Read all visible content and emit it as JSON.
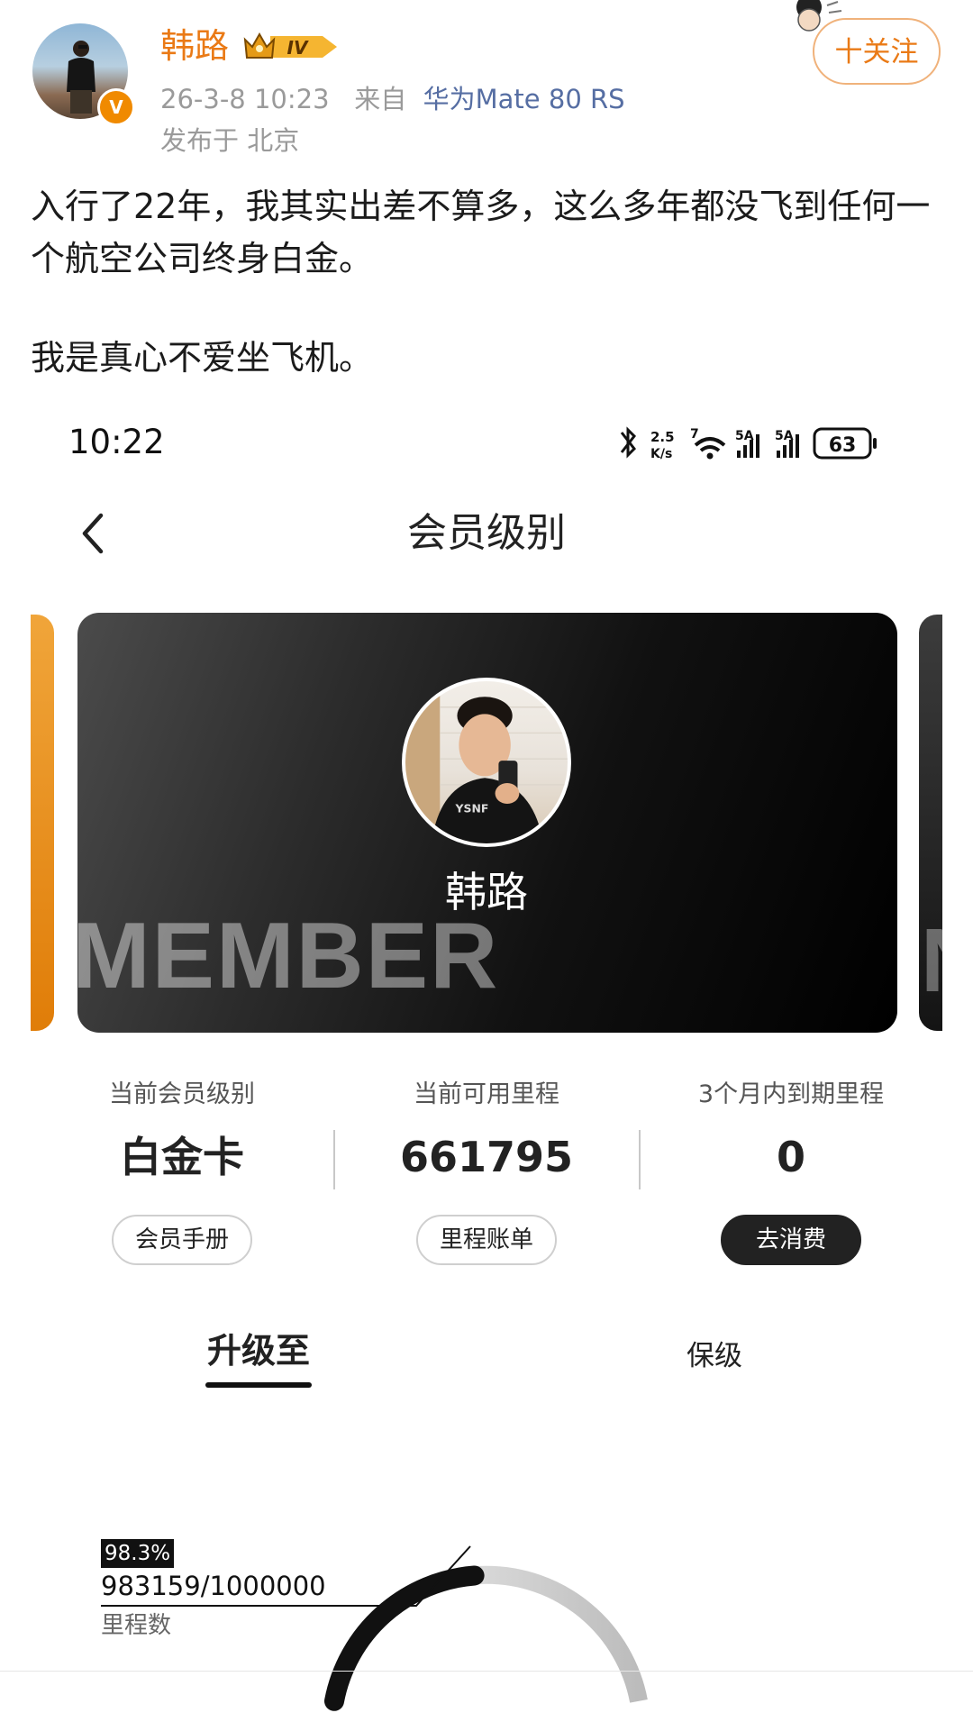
{
  "post": {
    "username": "韩路",
    "vip_level": "IV",
    "timestamp": "26-3-8 10:23",
    "source_prefix": "来自",
    "source_device": "华为Mate 80 RS",
    "location": "发布于 北京",
    "follow_label": "十关注",
    "verified_mark": "V",
    "text_line1": "入行了22年，我其实出差不算多，这么多年都没飞到任何一个航空公司终身白金。",
    "text_line2": "我是真心不爱坐飞机。"
  },
  "phone": {
    "status_time": "10:22",
    "net_speed_value": "2.5",
    "net_speed_unit": "K/s",
    "wifi_label": "7",
    "sim1_label": "5A",
    "sim2_label": "5A",
    "battery": "63",
    "screen_title": "会员级别",
    "card": {
      "name": "韩路",
      "watermark": "MEMBER",
      "right_watermark": "N"
    },
    "stats": [
      {
        "label": "当前会员级别",
        "value": "白金卡",
        "button": "会员手册"
      },
      {
        "label": "当前可用里程",
        "value": "661795",
        "button": "里程账单"
      },
      {
        "label": "3个月内到期里程",
        "value": "0",
        "button": "去消费"
      }
    ],
    "tabs": [
      {
        "label": "升级至",
        "active": true
      },
      {
        "label": "保级",
        "active": false
      }
    ],
    "progress": {
      "percent_label": "98.3%",
      "value_text": "983159/1000000",
      "label": "里程数",
      "fraction": 0.983
    }
  },
  "colors": {
    "brand_orange": "#ea7a16",
    "link_blue": "#566ea3",
    "card_dark": "#111111"
  }
}
